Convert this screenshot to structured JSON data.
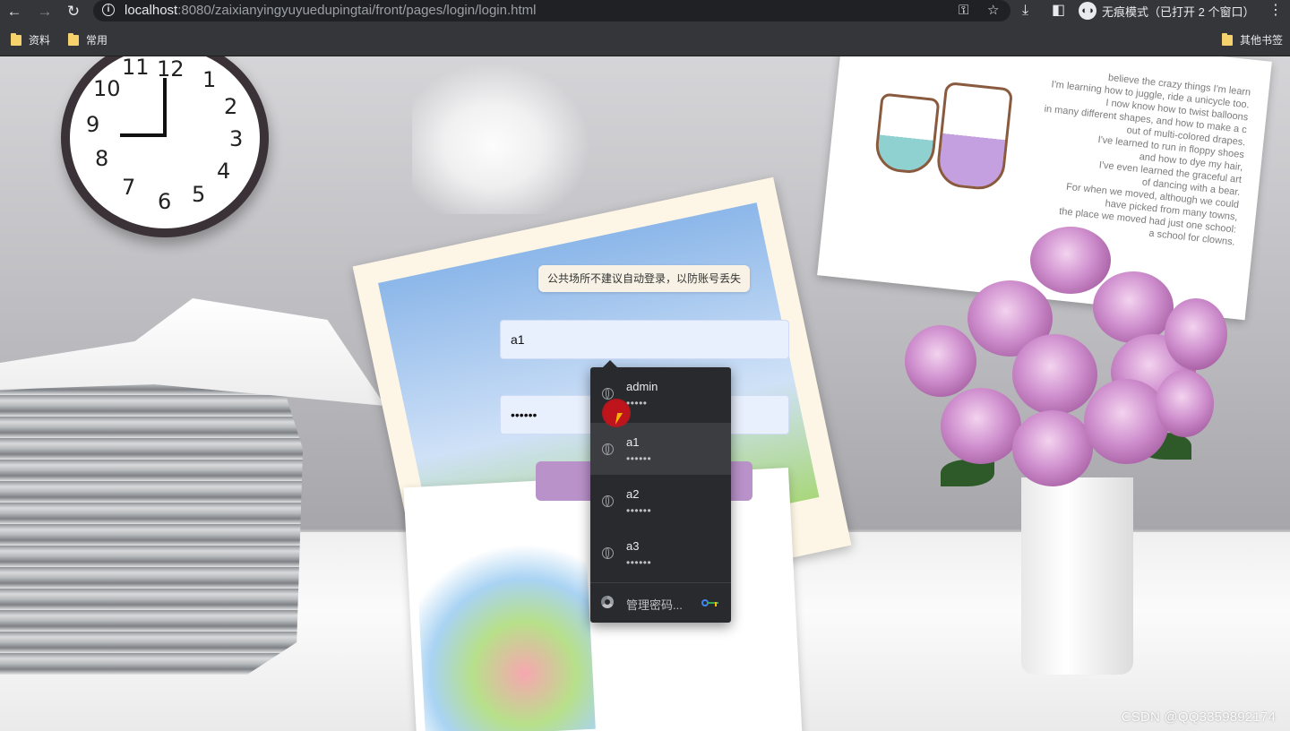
{
  "browser": {
    "url_host": "localhost",
    "url_rest": ":8080/zaixianyingyuyuedupingtai/front/pages/login/login.html",
    "incognito_label": "无痕模式（已打开 2 个窗口）",
    "icons": {
      "back": "arrow-left-icon",
      "forward": "arrow-right-icon",
      "reload": "reload-icon",
      "site_info": "info-icon",
      "password": "key-icon",
      "bookmark": "star-icon",
      "download": "download-icon",
      "side_panel": "side-panel-icon",
      "menu": "more-vertical-icon"
    }
  },
  "bookmarks": {
    "items": [
      {
        "label": "资料"
      },
      {
        "label": "常用"
      }
    ],
    "other": "其他书签"
  },
  "clock": {
    "numbers": [
      "12",
      "1",
      "2",
      "3",
      "4",
      "5",
      "6",
      "7",
      "8",
      "9",
      "10",
      "11"
    ]
  },
  "paper_text": [
    "believe the crazy things I'm learn",
    "I'm learning how to juggle, ride a unicycle too.",
    "I now know how to twist balloons",
    "in many different shapes, and how to make a c",
    "out of multi-colored drapes.",
    "I've learned to run in floppy shoes",
    "and how to dye my hair,",
    "I've even learned the graceful art",
    "of dancing with a bear.",
    "For when we moved, although we could",
    "have picked from many towns,",
    "the place we moved had just one school:",
    "a school for clowns."
  ],
  "login": {
    "tip": "公共场所不建议自动登录，以防账号丢失",
    "username_value": "a1",
    "password_value": "••••••"
  },
  "autofill": {
    "credentials": [
      {
        "user": "admin",
        "pass": "•••••"
      },
      {
        "user": "a1",
        "pass": "••••••"
      },
      {
        "user": "a2",
        "pass": "••••••"
      },
      {
        "user": "a3",
        "pass": "••••••"
      }
    ],
    "manage_label": "管理密码...",
    "colors": {
      "background": "#292a2d",
      "hover": "#3c3d41"
    }
  },
  "watermark": "CSDN @QQ3359892174",
  "colors": {
    "chrome_bg": "#35363a",
    "input_bg": "#e8f0fe",
    "login_button": "#b992c9",
    "tip_bg": "#f7f2e5"
  }
}
